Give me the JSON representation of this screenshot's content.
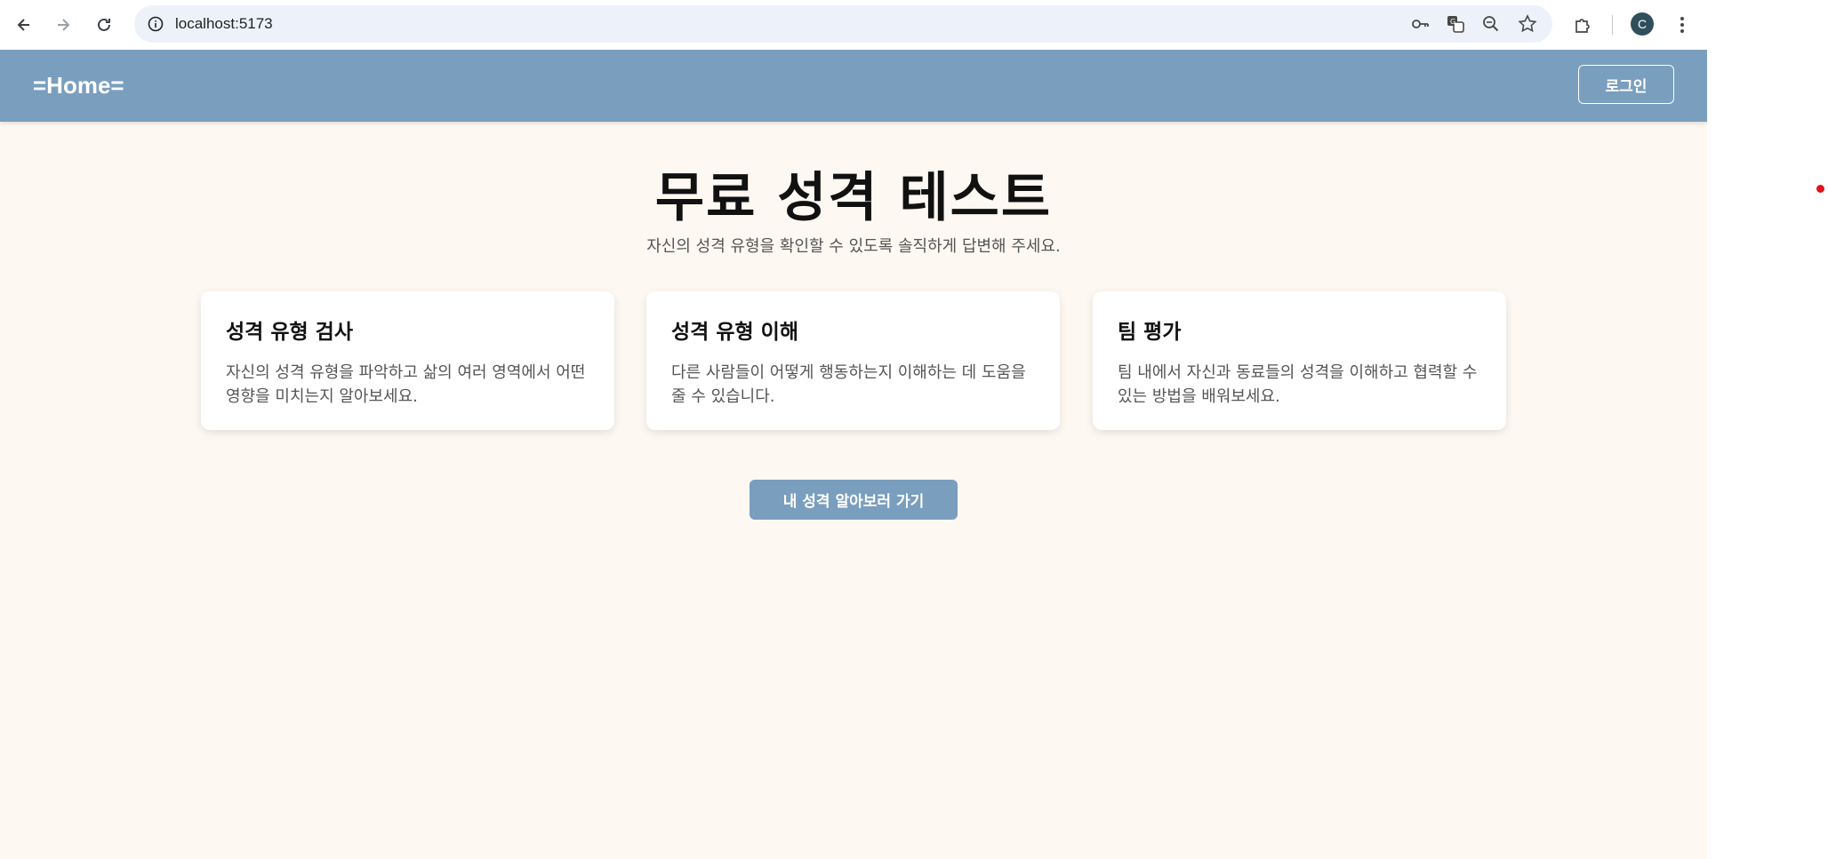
{
  "browser": {
    "url": "localhost:5173",
    "profile_initial": "C",
    "icons": {
      "back": "back-arrow-icon",
      "forward": "forward-arrow-icon",
      "reload": "reload-icon",
      "site_info": "info-icon",
      "password": "key-icon",
      "translate": "translate-icon",
      "zoom": "zoom-icon",
      "bookmark": "star-icon",
      "extensions": "puzzle-icon",
      "menu": "kebab-menu-icon"
    }
  },
  "header": {
    "brand": "=Home=",
    "login_label": "로그인"
  },
  "hero": {
    "title": "무료 성격 테스트",
    "subtitle": "자신의 성격 유형을 확인할 수 있도록 솔직하게 답변해 주세요."
  },
  "cards": [
    {
      "title": "성격 유형 검사",
      "description": "자신의 성격 유형을 파악하고 삶의 여러 영역에서 어떤 영향을 미치는지 알아보세요."
    },
    {
      "title": "성격 유형 이해",
      "description": "다른 사람들이 어떻게 행동하는지 이해하는 데 도움을 줄 수 있습니다."
    },
    {
      "title": "팀 평가",
      "description": "팀 내에서 자신과 동료들의 성격을 이해하고 협력할 수 있는 방법을 배워보세요."
    }
  ],
  "cta": {
    "label": "내 성격 알아보러 가기"
  },
  "colors": {
    "header_bg": "#7a9ebe",
    "page_bg": "#fdf8f2",
    "button_bg": "#7a9ebe"
  }
}
